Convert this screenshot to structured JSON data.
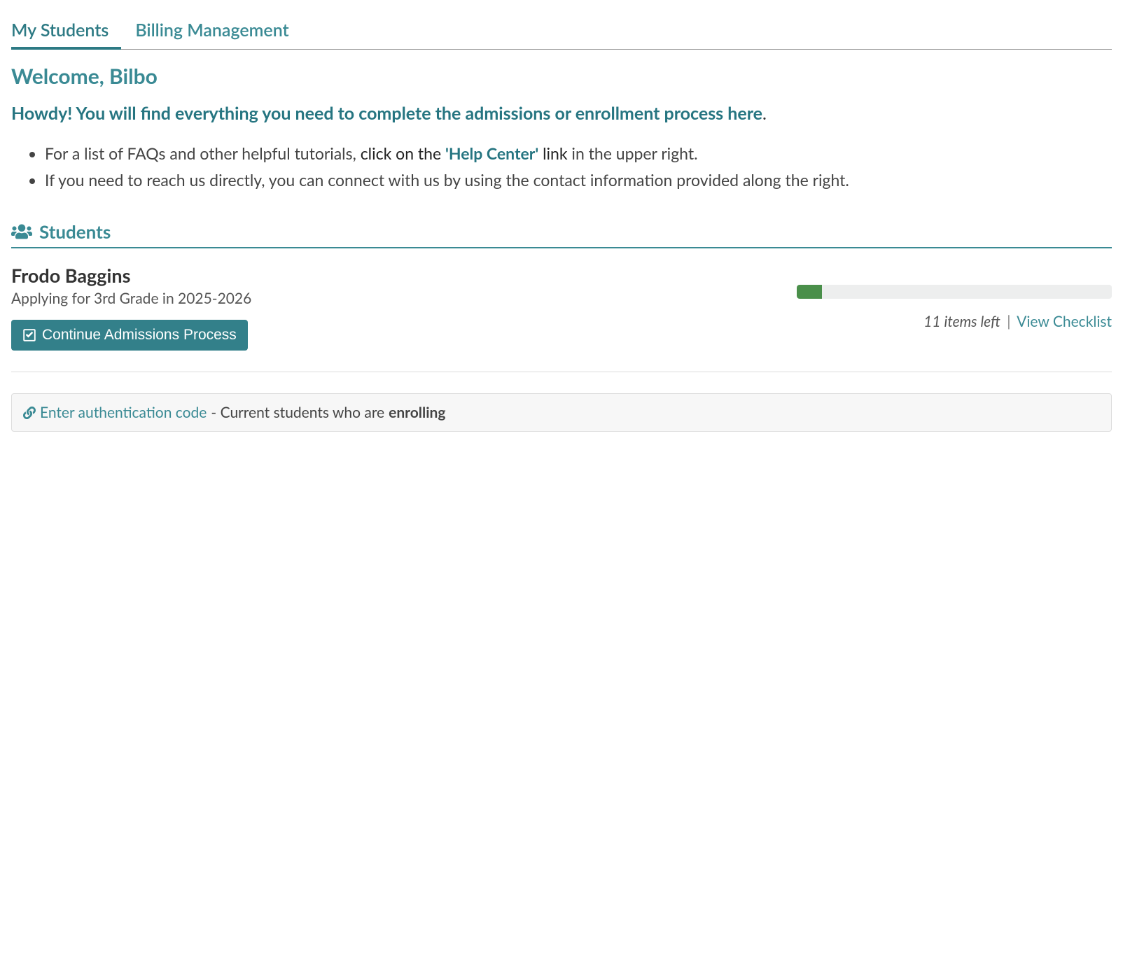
{
  "tabs": {
    "my_students": "My Students",
    "billing": "Billing Management"
  },
  "welcome": {
    "heading": "Welcome, Bilbo",
    "intro": "Howdy! You will find everything you need to complete the admissions or enrollment process here",
    "bullet1_pre": "For a list of FAQs and other helpful tutorials, ",
    "bullet1_dark1": "click on the ",
    "bullet1_help": "'Help Center'",
    "bullet1_dark2": " link",
    "bullet1_post": " in the upper right.",
    "bullet2": "If you need to reach us directly, you can connect with us by using the contact information provided along the right."
  },
  "section": {
    "students_label": "Students"
  },
  "student": {
    "name": "Frodo Baggins",
    "subtitle": "Applying for 3rd Grade in 2025-2026",
    "continue_label": "Continue Admissions Process",
    "items_left": "11 items left",
    "view_checklist": "View Checklist",
    "progress_percent": 8
  },
  "auth": {
    "link_text": "Enter authentication code",
    "desc_pre": " - Current students who are ",
    "desc_bold": "enrolling"
  }
}
